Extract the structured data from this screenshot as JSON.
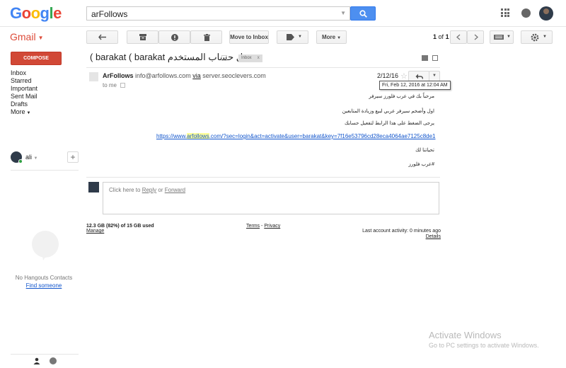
{
  "header": {
    "logo": "Google",
    "search_value": "arFollows",
    "search_placeholder": "",
    "colors": {
      "search_button": "#4d8ff0",
      "compose": "#d14836",
      "gmail_label": "#dd4b39",
      "link": "#1155cc"
    }
  },
  "toolbar": {
    "gmail_label": "Gmail",
    "move_to_inbox": "Move to Inbox",
    "more_label": "More",
    "page_current": "1",
    "page_of": "of",
    "page_total": "1"
  },
  "sidebar": {
    "compose_label": "COMPOSE",
    "items": [
      {
        "label": "Inbox"
      },
      {
        "label": "Starred"
      },
      {
        "label": "Important"
      },
      {
        "label": "Sent Mail"
      },
      {
        "label": "Drafts"
      },
      {
        "label": "More"
      }
    ],
    "hangouts_user": "ali",
    "no_contacts": "No Hangouts Contacts",
    "find_someone": "Find someone"
  },
  "conversation": {
    "subject_ltr": "( barakat ( barakat",
    "subject_rtl": "تفعيل حساب المستخدم",
    "label_tag": "Inbox",
    "label_close": "x"
  },
  "message": {
    "sender_name": "ArFollows",
    "sender_email": "info@arfollows.com",
    "via_label": "via",
    "via_domain": "server.seoclevers.com",
    "to": "to me",
    "date_short": "2/12/16",
    "date_full": "Fri, Feb 12, 2016 at 12:04 AM",
    "body_lines": [
      "مرحباً بك في عرب فلورز سيرفر",
      "اول وأضخم سيرفر عربي لبيع وزيادة المتابعين",
      "يرجى الضغط على هذا الرابط لتفعيل حسابك",
      "تحياتنا لك",
      "#عرب فلورز"
    ],
    "link_prefix": "https://www.",
    "link_highlight": "arfollows",
    "link_suffix": ".com/?sec=login&act=activate&user=barakat&key=7f16e53796cd28eca4064ae7125c8de1"
  },
  "reply": {
    "prefix": "Click here to",
    "reply": "Reply",
    "or": "or",
    "forward": "Forward"
  },
  "footer": {
    "storage": "12.3 GB (82%) of 15 GB used",
    "manage": "Manage",
    "terms": "Terms",
    "dash": "-",
    "privacy": "Privacy",
    "last_activity": "Last account activity: 0 minutes ago",
    "details": "Details"
  },
  "overlay": {
    "activate_title": "Activate Windows",
    "activate_sub": "Go to PC settings to activate Windows."
  }
}
